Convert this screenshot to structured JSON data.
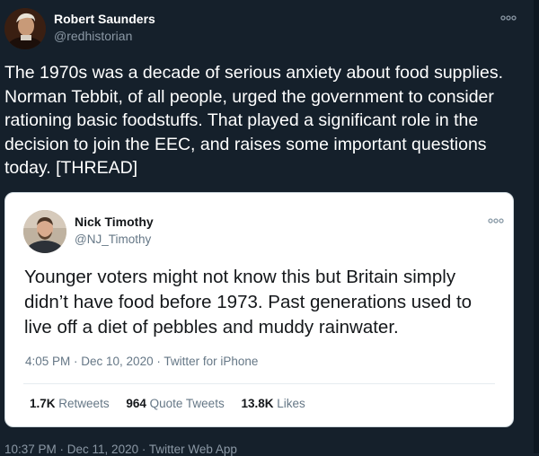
{
  "tweet": {
    "author_name": "Robert Saunders",
    "author_handle": "@redhistorian",
    "text": "The 1970s was a decade of serious anxiety about food supplies. Norman Tebbit, of all people, urged the government to consider rationing basic foodstuffs. That played a significant role in the decision to join the EEC, and raises some important questions today. [THREAD]",
    "meta": "10:37 PM · Dec 11, 2020 · Twitter Web App"
  },
  "quote": {
    "author_name": "Nick Timothy",
    "author_handle": "@NJ_Timothy",
    "text": "Younger voters might not know this but Britain simply didn’t have food before 1973. Past generations used to live off a diet of pebbles and muddy rainwater.",
    "meta": "4:05 PM · Dec 10, 2020 · Twitter for iPhone",
    "stats": {
      "retweets_count": "1.7K",
      "retweets_label": "Retweets",
      "quotes_count": "964",
      "quotes_label": "Quote Tweets",
      "likes_count": "13.8K",
      "likes_label": "Likes"
    }
  },
  "icons": {
    "more_main": "more-options-icon",
    "more_quote": "more-options-icon"
  },
  "colors": {
    "background": "#15202b",
    "card_background": "#ffffff",
    "secondary_text": "#8b98a5"
  }
}
